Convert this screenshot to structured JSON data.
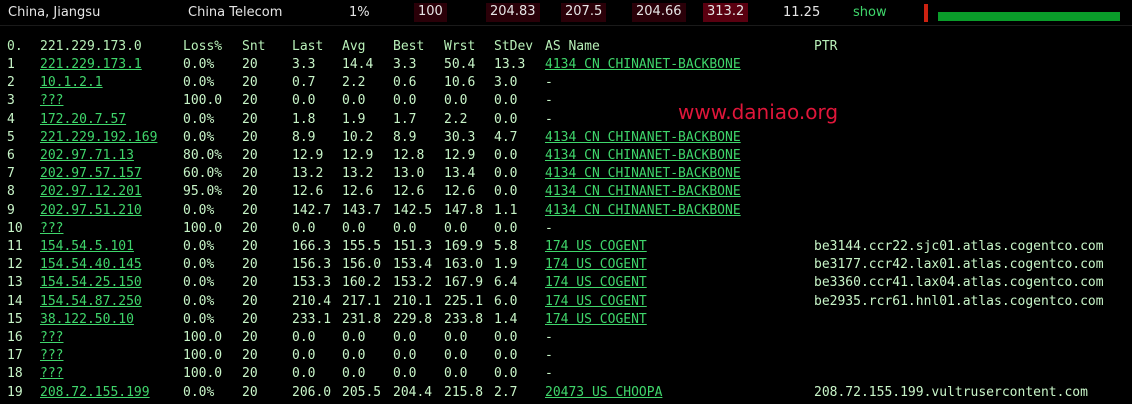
{
  "topbar": {
    "location": "China, Jiangsu",
    "isp": "China Telecom",
    "loss": "1%",
    "sent": "100",
    "last": "204.83",
    "avg": "207.5",
    "best": "204.66",
    "worst": "313.2",
    "stdev": "11.25",
    "show_link": "show"
  },
  "watermark": "www.daniao.org",
  "headers": {
    "hop": "0.",
    "host": "221.229.173.0",
    "loss": "Loss%",
    "snt": "Snt",
    "last": "Last",
    "avg": "Avg",
    "best": "Best",
    "wrst": "Wrst",
    "stdev": "StDev",
    "asname": "AS Name",
    "ptr": "PTR"
  },
  "rows": [
    {
      "hop": "1",
      "host": "221.229.173.1",
      "loss": "0.0%",
      "snt": "20",
      "last": "3.3",
      "avg": "14.4",
      "best": "3.3",
      "wrst": "50.4",
      "stdev": "13.3",
      "asname": "4134  CN CHINANET-BACKBONE",
      "ptr": ""
    },
    {
      "hop": "2",
      "host": "10.1.2.1",
      "loss": "0.0%",
      "snt": "20",
      "last": "0.7",
      "avg": "2.2",
      "best": "0.6",
      "wrst": "10.6",
      "stdev": "3.0",
      "asname": "-",
      "ptr": ""
    },
    {
      "hop": "3",
      "host": "???",
      "loss": "100.0",
      "snt": "20",
      "last": "0.0",
      "avg": "0.0",
      "best": "0.0",
      "wrst": "0.0",
      "stdev": "0.0",
      "asname": "-",
      "ptr": ""
    },
    {
      "hop": "4",
      "host": "172.20.7.57",
      "loss": "0.0%",
      "snt": "20",
      "last": "1.8",
      "avg": "1.9",
      "best": "1.7",
      "wrst": "2.2",
      "stdev": "0.0",
      "asname": "-",
      "ptr": ""
    },
    {
      "hop": "5",
      "host": "221.229.192.169",
      "loss": "0.0%",
      "snt": "20",
      "last": "8.9",
      "avg": "10.2",
      "best": "8.9",
      "wrst": "30.3",
      "stdev": "4.7",
      "asname": "4134  CN CHINANET-BACKBONE",
      "ptr": ""
    },
    {
      "hop": "6",
      "host": "202.97.71.13",
      "loss": "80.0%",
      "snt": "20",
      "last": "12.9",
      "avg": "12.9",
      "best": "12.8",
      "wrst": "12.9",
      "stdev": "0.0",
      "asname": "4134  CN CHINANET-BACKBONE",
      "ptr": ""
    },
    {
      "hop": "7",
      "host": "202.97.57.157",
      "loss": "60.0%",
      "snt": "20",
      "last": "13.2",
      "avg": "13.2",
      "best": "13.0",
      "wrst": "13.4",
      "stdev": "0.0",
      "asname": "4134  CN CHINANET-BACKBONE",
      "ptr": ""
    },
    {
      "hop": "8",
      "host": "202.97.12.201",
      "loss": "95.0%",
      "snt": "20",
      "last": "12.6",
      "avg": "12.6",
      "best": "12.6",
      "wrst": "12.6",
      "stdev": "0.0",
      "asname": "4134  CN CHINANET-BACKBONE",
      "ptr": ""
    },
    {
      "hop": "9",
      "host": "202.97.51.210",
      "loss": "0.0%",
      "snt": "20",
      "last": "142.7",
      "avg": "143.7",
      "best": "142.5",
      "wrst": "147.8",
      "stdev": "1.1",
      "asname": "4134  CN CHINANET-BACKBONE",
      "ptr": ""
    },
    {
      "hop": "10",
      "host": "???",
      "loss": "100.0",
      "snt": "20",
      "last": "0.0",
      "avg": "0.0",
      "best": "0.0",
      "wrst": "0.0",
      "stdev": "0.0",
      "asname": "-",
      "ptr": ""
    },
    {
      "hop": "11",
      "host": "154.54.5.101",
      "loss": "0.0%",
      "snt": "20",
      "last": "166.3",
      "avg": "155.5",
      "best": "151.3",
      "wrst": "169.9",
      "stdev": "5.8",
      "asname": "174   US COGENT",
      "ptr": "be3144.ccr22.sjc01.atlas.cogentco.com"
    },
    {
      "hop": "12",
      "host": "154.54.40.145",
      "loss": "0.0%",
      "snt": "20",
      "last": "156.3",
      "avg": "156.0",
      "best": "153.4",
      "wrst": "163.0",
      "stdev": "1.9",
      "asname": "174   US COGENT",
      "ptr": "be3177.ccr42.lax01.atlas.cogentco.com"
    },
    {
      "hop": "13",
      "host": "154.54.25.150",
      "loss": "0.0%",
      "snt": "20",
      "last": "153.3",
      "avg": "160.2",
      "best": "153.2",
      "wrst": "167.9",
      "stdev": "6.4",
      "asname": "174   US COGENT",
      "ptr": "be3360.ccr41.lax04.atlas.cogentco.com"
    },
    {
      "hop": "14",
      "host": "154.54.87.250",
      "loss": "0.0%",
      "snt": "20",
      "last": "210.4",
      "avg": "217.1",
      "best": "210.1",
      "wrst": "225.1",
      "stdev": "6.0",
      "asname": "174   US COGENT",
      "ptr": "be2935.rcr61.hnl01.atlas.cogentco.com"
    },
    {
      "hop": "15",
      "host": "38.122.50.10",
      "loss": "0.0%",
      "snt": "20",
      "last": "233.1",
      "avg": "231.8",
      "best": "229.8",
      "wrst": "233.8",
      "stdev": "1.4",
      "asname": "174   US COGENT",
      "ptr": ""
    },
    {
      "hop": "16",
      "host": "???",
      "loss": "100.0",
      "snt": "20",
      "last": "0.0",
      "avg": "0.0",
      "best": "0.0",
      "wrst": "0.0",
      "stdev": "0.0",
      "asname": "-",
      "ptr": ""
    },
    {
      "hop": "17",
      "host": "???",
      "loss": "100.0",
      "snt": "20",
      "last": "0.0",
      "avg": "0.0",
      "best": "0.0",
      "wrst": "0.0",
      "stdev": "0.0",
      "asname": "-",
      "ptr": ""
    },
    {
      "hop": "18",
      "host": "???",
      "loss": "100.0",
      "snt": "20",
      "last": "0.0",
      "avg": "0.0",
      "best": "0.0",
      "wrst": "0.0",
      "stdev": "0.0",
      "asname": "-",
      "ptr": ""
    },
    {
      "hop": "19",
      "host": "208.72.155.199",
      "loss": "0.0%",
      "snt": "20",
      "last": "206.0",
      "avg": "205.5",
      "best": "204.4",
      "wrst": "215.8",
      "stdev": "2.7",
      "asname": "20473 US CHOOPA",
      "ptr": "208.72.155.199.vultrusercontent.com"
    }
  ]
}
